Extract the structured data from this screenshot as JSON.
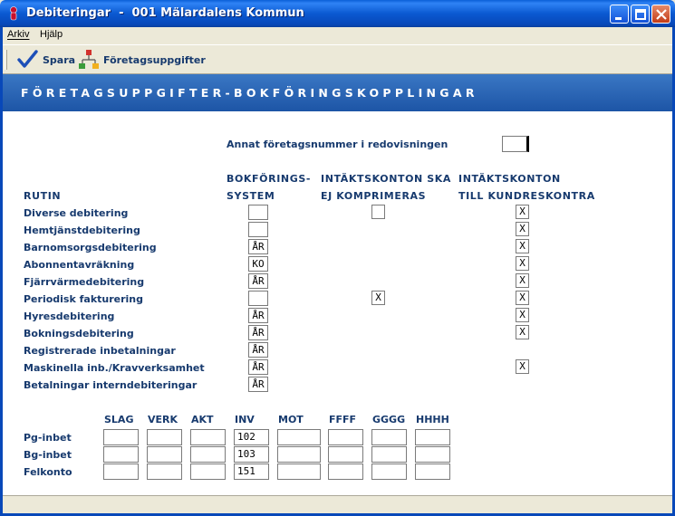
{
  "window": {
    "title": "Debiteringar  -  001 Mälardalens Kommun"
  },
  "menu": {
    "items": [
      "Arkiv",
      "Hjälp"
    ]
  },
  "toolbar": {
    "save_label": "Spara",
    "company_label": "Företagsuppgifter"
  },
  "header": {
    "title": "FÖRETAGSUPPGIFTER-BOKFÖRINGSKOPPLINGAR"
  },
  "other_company": {
    "label": "Annat företagsnummer i redovisningen",
    "value": ""
  },
  "columns": {
    "rutin": "RUTIN",
    "bok1": "BOKFÖRINGS-",
    "bok2": "SYSTEM",
    "komp1": "INTÄKTSKONTON SKA",
    "komp2": "EJ KOMPRIMERAS",
    "kund1": "INTÄKTSKONTON",
    "kund2": "TILL KUNDRESKONTRA"
  },
  "rows": [
    {
      "label": "Diverse debitering",
      "system": "",
      "komp": "",
      "kund": "X"
    },
    {
      "label": "Hemtjänstdebitering",
      "system": "",
      "komp": null,
      "kund": "X"
    },
    {
      "label": "Barnomsorgsdebitering",
      "system": "ÅR",
      "komp": null,
      "kund": "X"
    },
    {
      "label": "Abonnentavräkning",
      "system": "KO",
      "komp": null,
      "kund": "X"
    },
    {
      "label": "Fjärrvärmedebitering",
      "system": "ÅR",
      "komp": null,
      "kund": "X"
    },
    {
      "label": "Periodisk fakturering",
      "system": "",
      "komp": "X",
      "kund": "X"
    },
    {
      "label": "Hyresdebitering",
      "system": "ÅR",
      "komp": null,
      "kund": "X"
    },
    {
      "label": "Bokningsdebitering",
      "system": "ÅR",
      "komp": null,
      "kund": "X"
    },
    {
      "label": "Registrerade inbetalningar",
      "system": "ÅR",
      "komp": null,
      "kund": null
    },
    {
      "label": "Maskinella inb./Kravverksamhet",
      "system": "ÅR",
      "komp": null,
      "kund": "X"
    },
    {
      "label": "Betalningar interndebiteringar",
      "system": "ÅR",
      "komp": null,
      "kund": null
    }
  ],
  "grid": {
    "columns": [
      "SLAG",
      "VERK",
      "AKT",
      "INV",
      "MOT",
      "FFFF",
      "GGGG",
      "HHHH"
    ],
    "rows": [
      {
        "label": "Pg-inbet",
        "values": [
          "",
          "",
          "",
          "102",
          "",
          "",
          "",
          ""
        ]
      },
      {
        "label": "Bg-inbet",
        "values": [
          "",
          "",
          "",
          "103",
          "",
          "",
          "",
          ""
        ]
      },
      {
        "label": "Felkonto",
        "values": [
          "",
          "",
          "",
          "151",
          "",
          "",
          "",
          ""
        ]
      }
    ]
  },
  "colors": {
    "title_bar": "#0a59d1",
    "header_band": "#2a66b6",
    "label_text": "#173a6e"
  }
}
